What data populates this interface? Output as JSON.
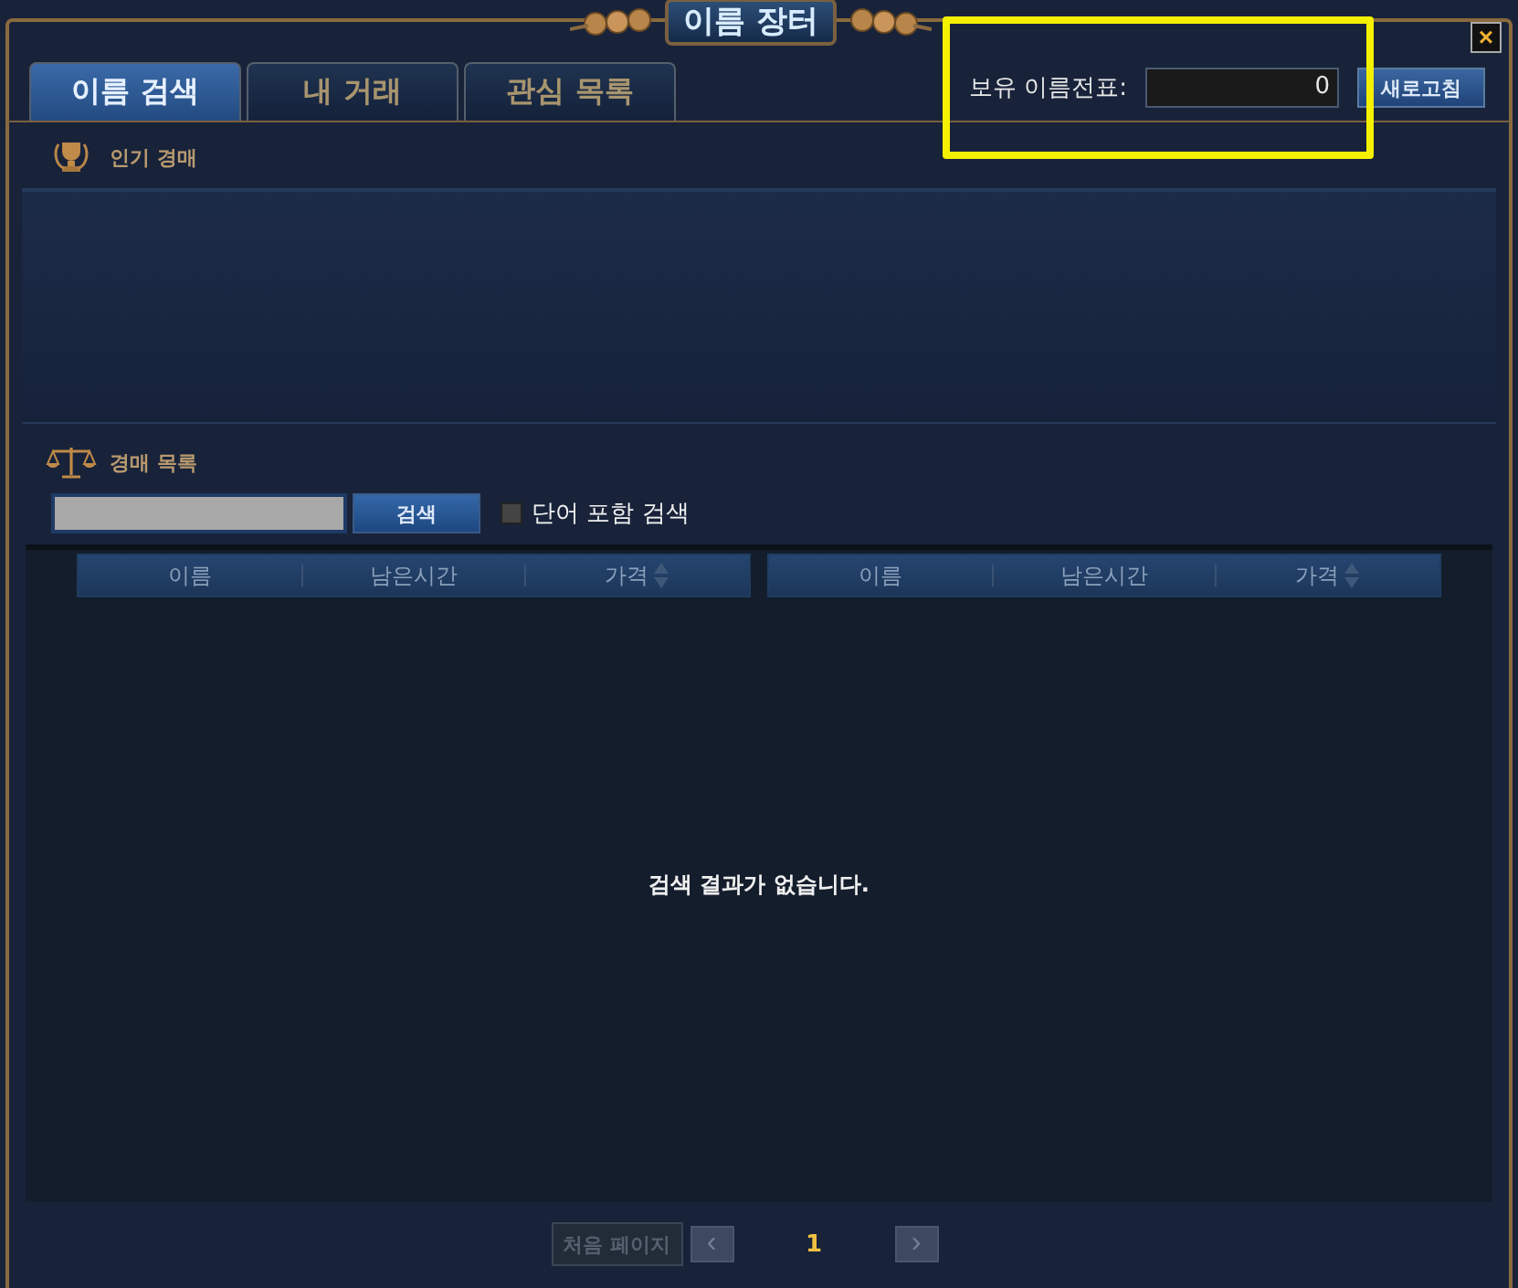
{
  "window": {
    "title": "이름 장터",
    "close": "×"
  },
  "tabs": [
    {
      "label": "이름 검색",
      "selected": true
    },
    {
      "label": "내 거래",
      "selected": false
    },
    {
      "label": "관심 목록",
      "selected": false
    }
  ],
  "balance": {
    "label": "보유 이름전표:",
    "value": "0",
    "highlighted": true
  },
  "refresh_button": "새로고침",
  "popular": {
    "heading": "인기 경매"
  },
  "auction": {
    "heading": "경매 목록",
    "search_button": "검색",
    "option": {
      "label": "단어 포함 검색",
      "checked": false
    }
  },
  "table": {
    "column_groups": [
      {
        "columns": [
          {
            "label": "이름",
            "kind": "plain"
          },
          {
            "label": "남은시간",
            "kind": "plain"
          },
          {
            "label": "가격",
            "kind": "sortable"
          }
        ]
      },
      {
        "columns": [
          {
            "label": "이름",
            "kind": "plain"
          },
          {
            "label": "남은시간",
            "kind": "plain"
          },
          {
            "label": "가격",
            "kind": "sortable"
          }
        ]
      }
    ],
    "empty_message": "검색 결과가 없습니다."
  },
  "pagination": {
    "first_button": {
      "label": "처음 페이지",
      "disabled": true
    },
    "prev": {
      "label": "‹",
      "disabled": true
    },
    "current_page": "1",
    "next": {
      "label": "›",
      "disabled": true
    }
  }
}
